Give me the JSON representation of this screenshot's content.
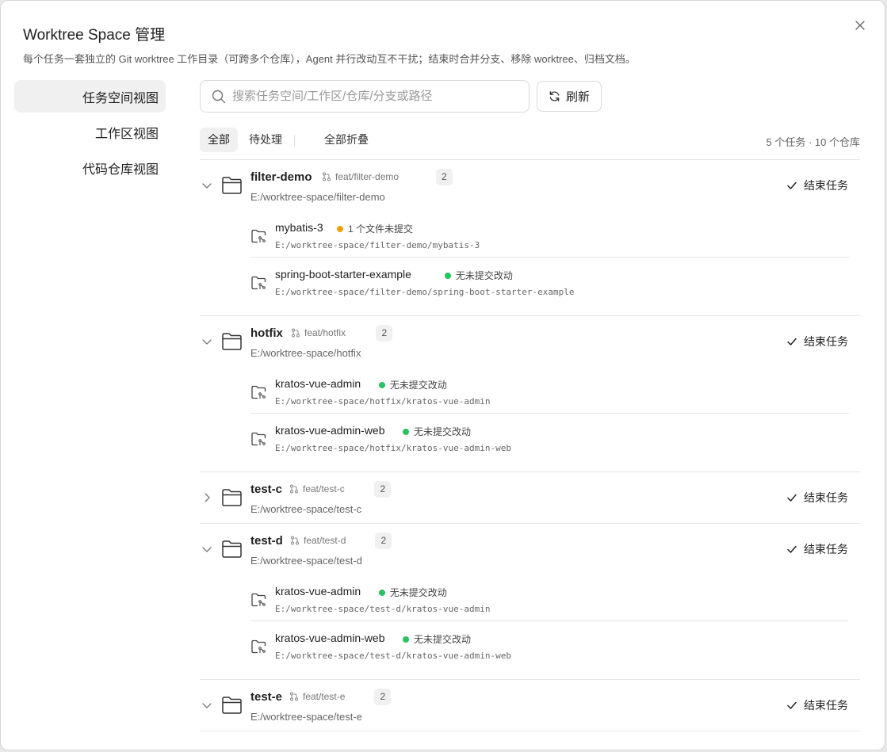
{
  "dialog": {
    "title": "Worktree Space 管理",
    "description": "每个任务一套独立的 Git worktree 工作目录（可跨多个仓库），Agent 并行改动互不干扰；结束时合并分支、移除 worktree、归档文档。"
  },
  "sidebar": {
    "items": [
      {
        "label": "任务空间视图",
        "active": true
      },
      {
        "label": "工作区视图",
        "active": false
      },
      {
        "label": "代码仓库视图",
        "active": false
      }
    ]
  },
  "search": {
    "placeholder": "搜索任务空间/工作区/仓库/分支或路径",
    "value": ""
  },
  "refresh_label": "刷新",
  "filters": {
    "all": "全部",
    "pending": "待处理",
    "collapse_all": "全部折叠"
  },
  "summary": "5 个任务 · 10 个仓库",
  "end_task_label": "结束任务",
  "colors": {
    "dirty": "#f59e0b",
    "clean": "#22c55e"
  },
  "tasks": [
    {
      "name": "filter-demo",
      "branch": "feat/filter-demo",
      "count": "2",
      "path": "E:/worktree-space/filter-demo",
      "expanded": true,
      "repos": [
        {
          "name": "mybatis-3",
          "status": "1 个文件未提交",
          "state": "dirty",
          "path": "E:/worktree-space/filter-demo/mybatis-3"
        },
        {
          "name": "spring-boot-starter-example",
          "status": "无未提交改动",
          "state": "clean",
          "path": "E:/worktree-space/filter-demo/spring-boot-starter-example"
        }
      ]
    },
    {
      "name": "hotfix",
      "branch": "feat/hotfix",
      "count": "2",
      "path": "E:/worktree-space/hotfix",
      "expanded": true,
      "repos": [
        {
          "name": "kratos-vue-admin",
          "status": "无未提交改动",
          "state": "clean",
          "path": "E:/worktree-space/hotfix/kratos-vue-admin"
        },
        {
          "name": "kratos-vue-admin-web",
          "status": "无未提交改动",
          "state": "clean",
          "path": "E:/worktree-space/hotfix/kratos-vue-admin-web"
        }
      ]
    },
    {
      "name": "test-c",
      "branch": "feat/test-c",
      "count": "2",
      "path": "E:/worktree-space/test-c",
      "expanded": false,
      "repos": []
    },
    {
      "name": "test-d",
      "branch": "feat/test-d",
      "count": "2",
      "path": "E:/worktree-space/test-d",
      "expanded": true,
      "repos": [
        {
          "name": "kratos-vue-admin",
          "status": "无未提交改动",
          "state": "clean",
          "path": "E:/worktree-space/test-d/kratos-vue-admin"
        },
        {
          "name": "kratos-vue-admin-web",
          "status": "无未提交改动",
          "state": "clean",
          "path": "E:/worktree-space/test-d/kratos-vue-admin-web"
        }
      ]
    },
    {
      "name": "test-e",
      "branch": "feat/test-e",
      "count": "2",
      "path": "E:/worktree-space/test-e",
      "expanded": true,
      "repos": []
    }
  ]
}
